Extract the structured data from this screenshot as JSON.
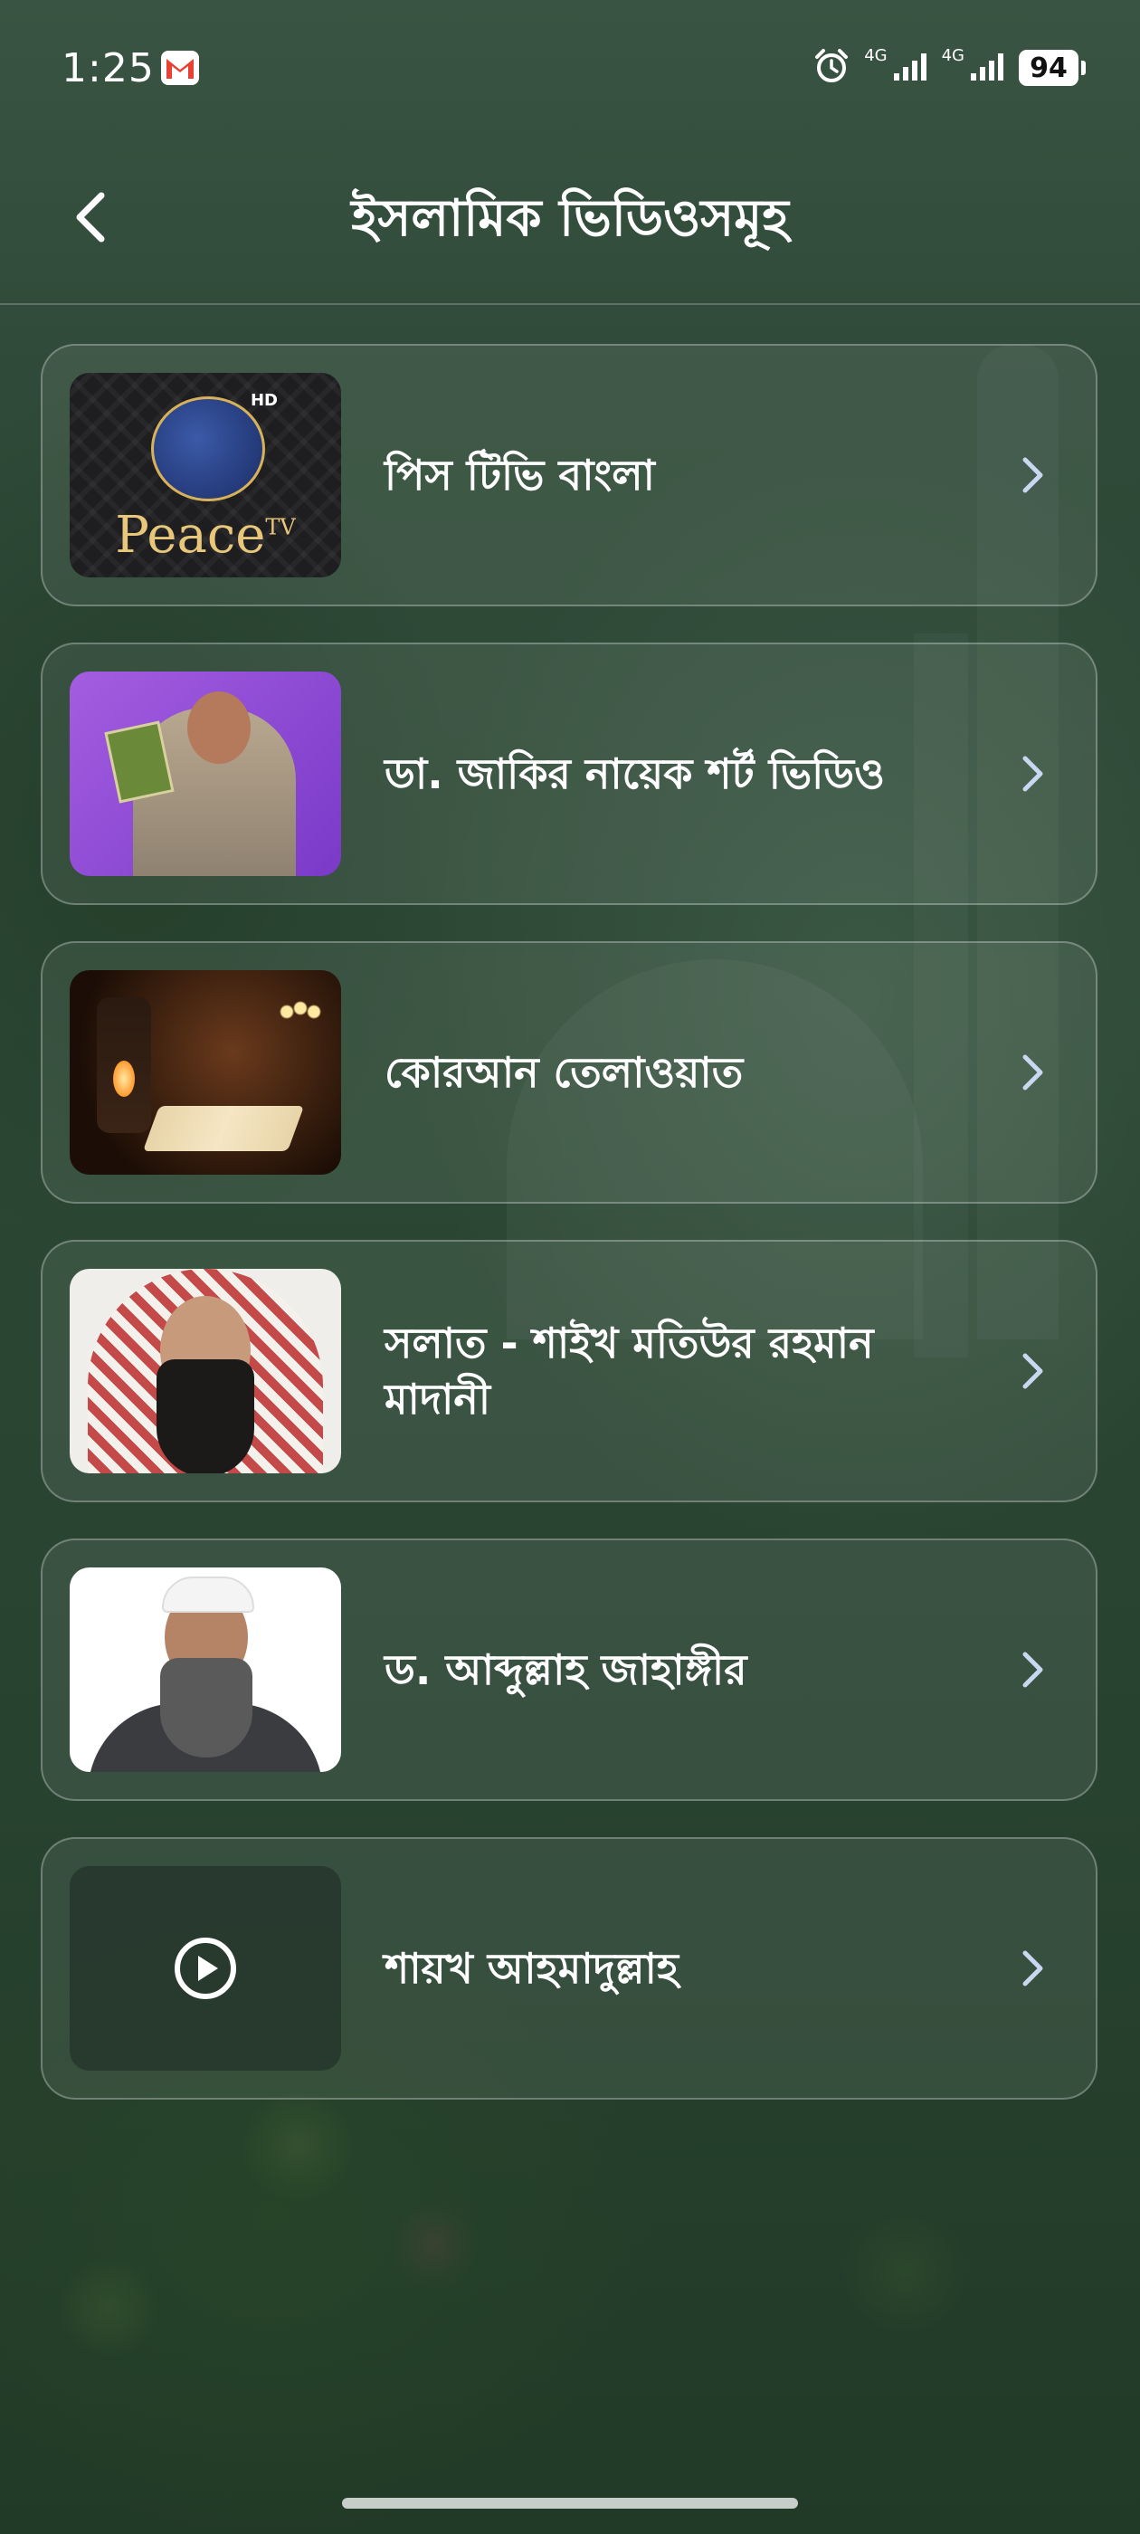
{
  "status_bar": {
    "time": "1:25",
    "network_1": "4G",
    "network_2": "4G",
    "battery": "94",
    "icons": [
      "gmail-icon",
      "alarm-icon",
      "signal-icon",
      "signal-icon"
    ]
  },
  "header": {
    "title": "ইসলামিক ভিডিওসমূহ",
    "back_icon": "back-arrow-icon"
  },
  "thumbnails": {
    "peace_tv_brand": "Peace",
    "peace_tv_suffix": "TV",
    "peace_tv_hd": "HD"
  },
  "items": [
    {
      "label": "পিস টিভি বাংলা",
      "thumbnail": "peace-tv-logo",
      "icon": "chevron-right-icon"
    },
    {
      "label": "ডা. জাকির নায়েক শর্ট ভিডিও",
      "thumbnail": "zakir-naik-photo",
      "icon": "chevron-right-icon"
    },
    {
      "label": "কোরআন তেলাওয়াত",
      "thumbnail": "quran-lantern-photo",
      "icon": "chevron-right-icon"
    },
    {
      "label": "সলাত - শাইখ মতিউর রহমান মাদানী",
      "thumbnail": "motiur-rahman-photo",
      "icon": "chevron-right-icon"
    },
    {
      "label": "ড. আব্দুল্লাহ জাহাঙ্গীর",
      "thumbnail": "abdullah-jahangir-photo",
      "icon": "chevron-right-icon"
    },
    {
      "label": "শায়খ আহমাদুল্লাহ",
      "thumbnail": "play-icon",
      "icon": "chevron-right-icon"
    }
  ],
  "colors": {
    "background": "#2b4733",
    "card_border": "#8aa090",
    "text": "#ffffff"
  }
}
